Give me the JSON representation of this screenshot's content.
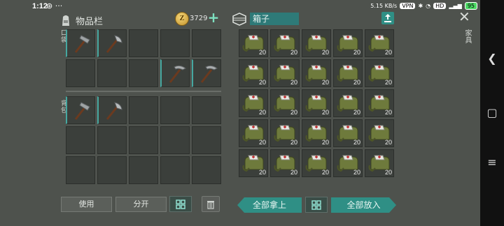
{
  "status_bar": {
    "time": "1:12",
    "dots": "⊛ ···",
    "speed": "5.15 KB/s",
    "battery": "95"
  },
  "inventory": {
    "title": "物品栏",
    "coins": "3729",
    "pocket_label": "口袋",
    "backpack_label": "背包",
    "pocket_rows": [
      [
        "sledgehammer",
        "hatchet",
        "",
        "",
        ""
      ],
      [
        "",
        "",
        "",
        "pickaxe",
        "pickaxe"
      ]
    ],
    "backpack_rows": [
      [
        "sledgehammer",
        "hatchet",
        "",
        "",
        ""
      ],
      [
        "",
        "",
        "",
        "",
        ""
      ],
      [
        "",
        "",
        "",
        "",
        ""
      ]
    ],
    "buttons": {
      "use": "使用",
      "split": "分开"
    }
  },
  "box": {
    "title": "箱子",
    "item": "medkit-bag",
    "quantity": "20",
    "rows": 5,
    "cols": 5,
    "take_all": "全部拿上",
    "put_all": "全部放入"
  },
  "side": {
    "category": "家具"
  },
  "colors": {
    "accent": "#2f8f85",
    "background": "#4e524d",
    "cell": "#3b3f3b"
  }
}
